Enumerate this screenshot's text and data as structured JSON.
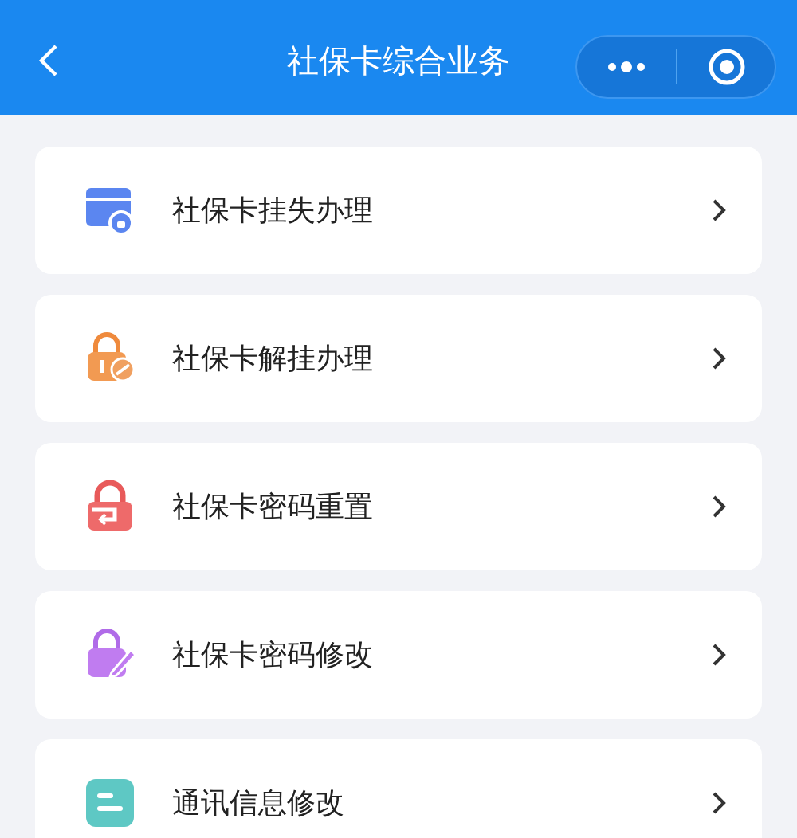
{
  "header": {
    "title": "社保卡综合业务"
  },
  "items": [
    {
      "kind": "card",
      "label": "社保卡挂失办理"
    },
    {
      "kind": "unlock",
      "label": "社保卡解挂办理"
    },
    {
      "kind": "reset",
      "label": "社保卡密码重置"
    },
    {
      "kind": "edit",
      "label": "社保卡密码修改"
    },
    {
      "kind": "contact",
      "label": "通讯信息修改"
    }
  ]
}
